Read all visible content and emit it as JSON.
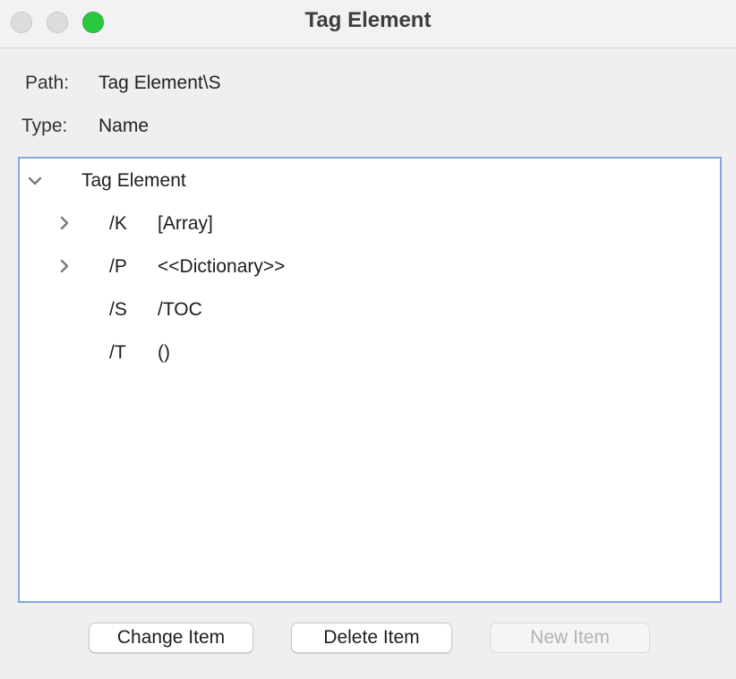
{
  "window": {
    "title": "Tag Element",
    "controls": [
      "close",
      "minimize",
      "zoom"
    ],
    "zoom_color": "#2ac840"
  },
  "info": {
    "path_label": "Path:",
    "path_value": "Tag Element\\S",
    "type_label": "Type:",
    "type_value": "Name"
  },
  "tree": {
    "root": {
      "label": "Tag Element",
      "expanded": true
    },
    "children": [
      {
        "key": "/K",
        "value": "[Array]",
        "expandable": true
      },
      {
        "key": "/P",
        "value": "<<Dictionary>>",
        "expandable": true
      },
      {
        "key": "/S",
        "value": "/TOC",
        "expandable": false
      },
      {
        "key": "/T",
        "value": "()",
        "expandable": false
      }
    ],
    "focus_border_color": "#86a4dd"
  },
  "buttons": {
    "change": {
      "label": "Change Item",
      "enabled": true
    },
    "delete": {
      "label": "Delete Item",
      "enabled": true
    },
    "new": {
      "label": "New Item",
      "enabled": false
    }
  }
}
